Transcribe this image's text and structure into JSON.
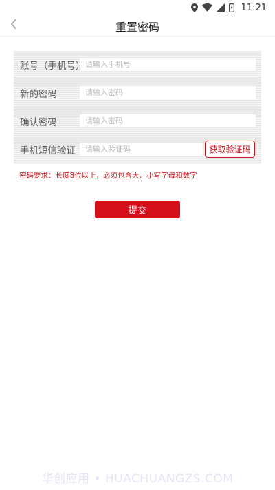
{
  "status_bar": {
    "time": "11:21",
    "icons": [
      "location-icon",
      "wifi-icon",
      "signal-icon",
      "battery-icon"
    ]
  },
  "header": {
    "back_icon": "chevron-left-icon",
    "title": "重置密码"
  },
  "form": {
    "account": {
      "label": "账号（手机号）",
      "placeholder": "请输入手机号"
    },
    "new_password": {
      "label": "新的密码",
      "placeholder": "请输入密码"
    },
    "confirm_password": {
      "label": "确认密码",
      "placeholder": "请输入密码"
    },
    "sms_code": {
      "label": "手机短信验证",
      "placeholder": "请输入验证码",
      "button": "获取验证码"
    }
  },
  "hint": "密码要求：长度8位以上，必须包含大、小写字母和数字",
  "submit_label": "提交",
  "watermark": "华创应用 • HUACHUANGZS.COM",
  "colors": {
    "accent": "#d40f1a",
    "hint": "#c9161e"
  }
}
